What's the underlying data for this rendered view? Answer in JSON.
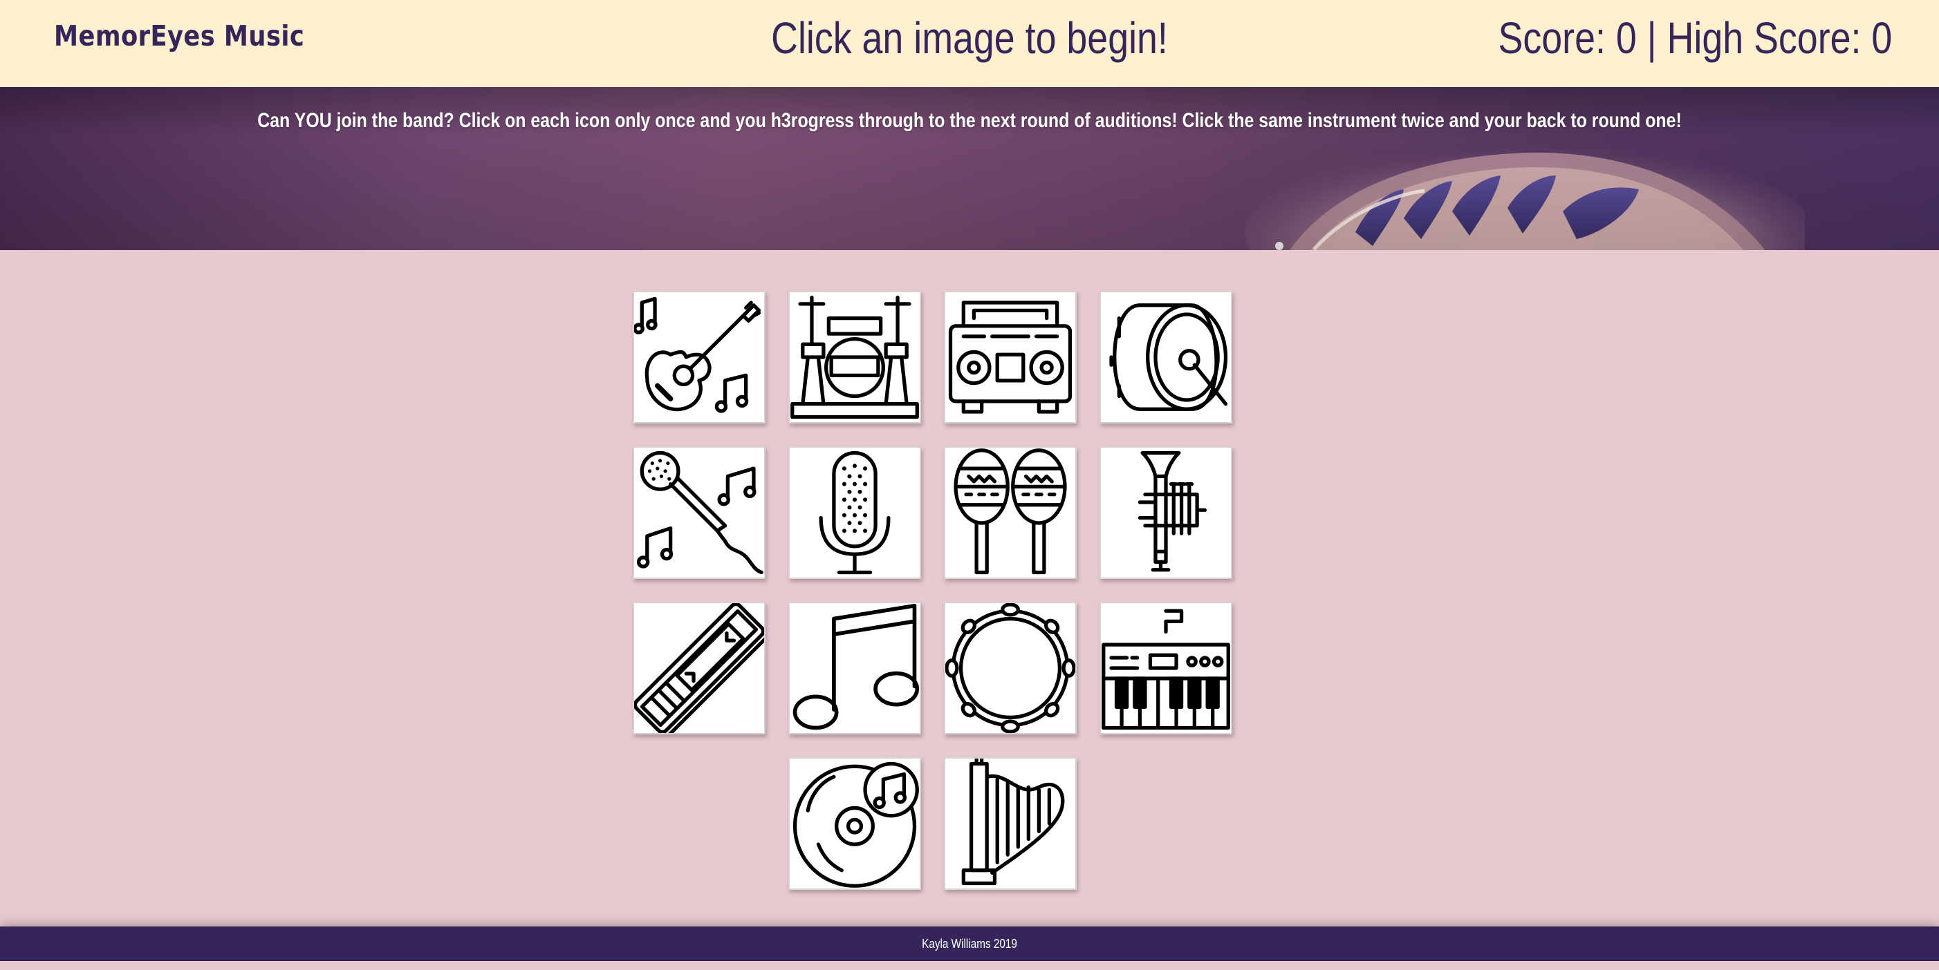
{
  "navbar": {
    "brand": "MemorEyes Music",
    "message": "Click an image to begin!",
    "score_text": "Score: 0 | High Score: 0"
  },
  "banner": {
    "instructions": "Can YOU join the band? Click on each icon only once and you h3rogress through to the next round of auditions! Click the same instrument twice and your back to round one!"
  },
  "cards": [
    {
      "icon": "guitar-icon"
    },
    {
      "icon": "drum-kit-icon"
    },
    {
      "icon": "boombox-icon"
    },
    {
      "icon": "bass-drum-icon"
    },
    {
      "icon": "karaoke-microphone-icon"
    },
    {
      "icon": "studio-microphone-icon"
    },
    {
      "icon": "maracas-icon"
    },
    {
      "icon": "trumpet-icon"
    },
    {
      "icon": "harmonica-icon"
    },
    {
      "icon": "music-note-icon"
    },
    {
      "icon": "tambourine-icon"
    },
    {
      "icon": "keyboard-synth-icon"
    },
    {
      "icon": "vinyl-record-icon"
    },
    {
      "icon": "harp-icon"
    }
  ],
  "footer": {
    "credit": "Kayla Williams 2019"
  },
  "colors": {
    "navbar_bg": "#fff1cf",
    "brand_text": "#36255a",
    "page_bg": "#e8c9cf",
    "footer_bg": "#36255a"
  }
}
